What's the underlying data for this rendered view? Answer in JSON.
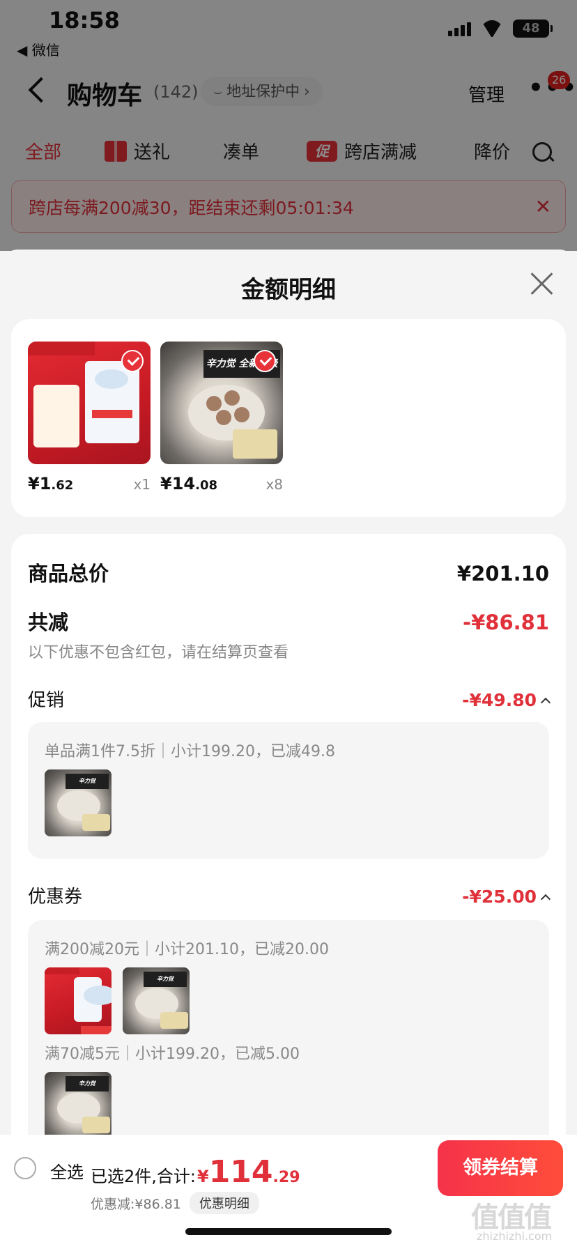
{
  "status_bar": {
    "time": "18:58",
    "back_app": "◀ 微信",
    "battery": "48"
  },
  "nav": {
    "title": "购物车",
    "count": "(142)",
    "address_protect": "地址保护中",
    "manage": "管理",
    "more": "•••",
    "badge": "26"
  },
  "tabs": [
    {
      "label": "全部"
    },
    {
      "label": "送礼"
    },
    {
      "label": "凑单"
    },
    {
      "label": "跨店满减",
      "icon_text": "促"
    },
    {
      "label": "降价"
    }
  ],
  "banner": {
    "text": "跨店每满200减30，距结束还剩05:01:34"
  },
  "sheet": {
    "title": "金额明细",
    "products": [
      {
        "price_int": "¥1",
        "price_dec": ".62",
        "qty": "x1",
        "image": "salt-pack",
        "selected": true
      },
      {
        "price_int": "¥14",
        "price_dec": ".08",
        "qty": "x8",
        "image": "meatball-bowl",
        "selected": true
      }
    ],
    "total_label": "商品总价",
    "total_value": "¥201.10",
    "discount_label": "共减",
    "discount_value": "-¥86.81",
    "discount_hint": "以下优惠不包含红包，请在结算页查看",
    "promo": {
      "label": "促销",
      "value": "-¥49.80",
      "rule": "单品满1件7.5折｜小计199.20，已减49.8"
    },
    "coupon": {
      "label": "优惠券",
      "value": "-¥25.00",
      "rules": [
        {
          "text": "满200减20元｜小计201.10，已减20.00"
        },
        {
          "text": "满70减5元｜小计199.20，已减5.00"
        }
      ]
    }
  },
  "bottom": {
    "select_all": "全选",
    "summary": "已选2件,合计:",
    "total_symbol": "¥",
    "total_int": "114",
    "total_dec": ".29",
    "discount": "优惠减:¥86.81",
    "detail_btn": "优惠明细",
    "checkout": "领券结算"
  },
  "watermark": {
    "main": "值值值",
    "sub": "zhizhizhi.com"
  },
  "colors": {
    "accent_red": "#e0303a",
    "checkout_gradient_start": "#f5324a",
    "checkout_gradient_end": "#ff4d3a"
  }
}
